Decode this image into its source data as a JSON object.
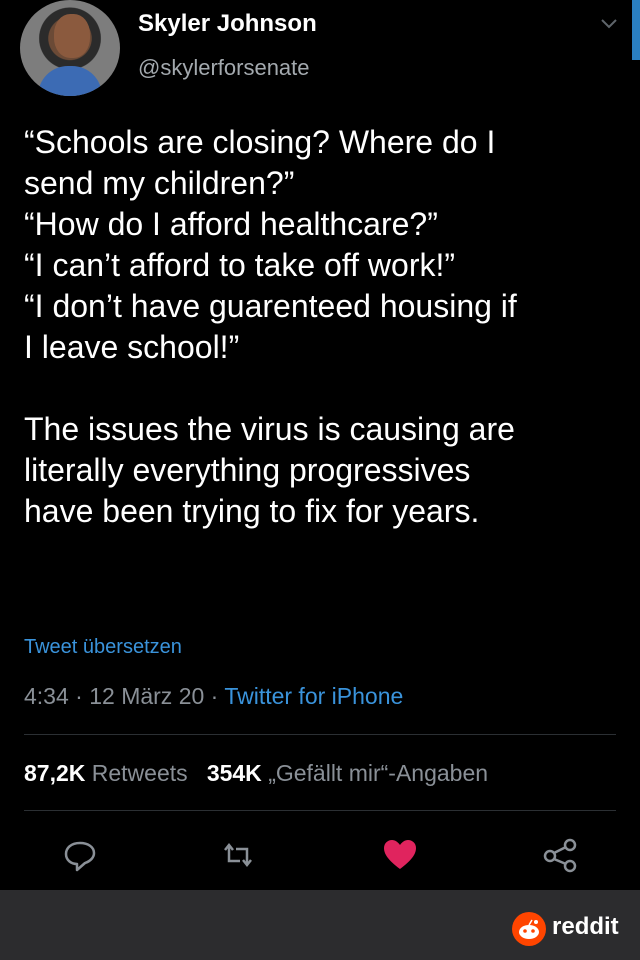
{
  "user": {
    "name": "Skyler Johnson",
    "handle": "@skylerforsenate"
  },
  "tweet": {
    "text": "“Schools are closing? Where do I\nsend my children?”\n“How do I afford healthcare?”\n“I can’t afford to take off work!”\n“I don’t have guarenteed housing if\nI leave school!”\n\nThe issues the virus is causing are\nliterally everything progressives\nhave been trying to fix for years.",
    "translate_label": "Tweet übersetzen",
    "time": "4:34",
    "date": "12 März 20",
    "separator": " · ",
    "source": "Twitter for iPhone"
  },
  "stats": {
    "retweets_count": "87,2K",
    "retweets_label": "Retweets",
    "likes_count": "354K",
    "likes_label": "„Gefällt mir“-Angaben"
  },
  "actions": {
    "icons": [
      "reply-icon",
      "retweet-icon",
      "like-icon",
      "share-icon"
    ],
    "like_color": "#e0245e",
    "action_color": "#8a9097"
  },
  "footer": {
    "brand": "reddit",
    "brand_color": "#ff4500"
  },
  "colors": {
    "background": "#000000",
    "link": "#3a93db",
    "secondary_text": "#8a9097"
  }
}
